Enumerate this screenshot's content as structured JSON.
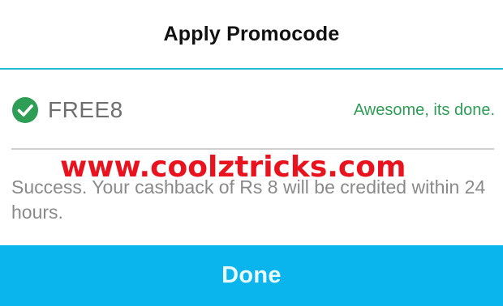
{
  "dialog": {
    "title": "Apply Promocode"
  },
  "promo": {
    "code": "FREE8",
    "status_text": "Awesome, its done.",
    "status_icon": "check-circle-icon",
    "status_color": "#2e9d55"
  },
  "watermark": {
    "text": "www.coolztricks.com",
    "color": "#e8131e"
  },
  "message": {
    "text": "Success. Your cashback of Rs 8 will be credited within 24 hours."
  },
  "actions": {
    "done_label": "Done",
    "done_color": "#0ab5ee"
  },
  "colors": {
    "accent_rule": "#27b8d9"
  }
}
